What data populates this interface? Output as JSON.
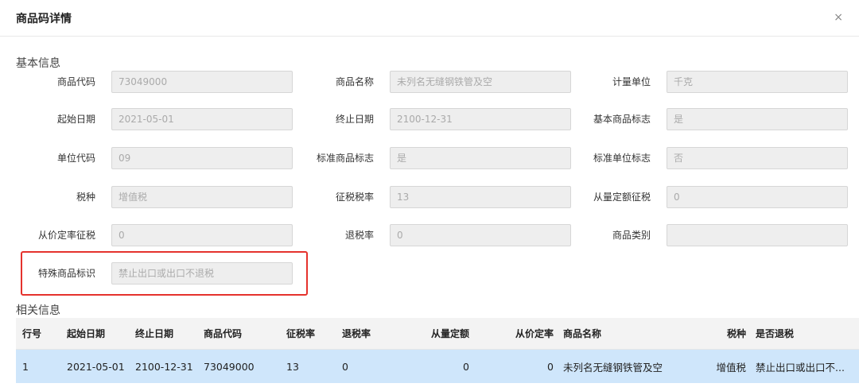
{
  "dialog": {
    "title": "商品码详情",
    "close_label": "×"
  },
  "basic": {
    "section_title": "基本信息",
    "fields": [
      {
        "label": "商品代码",
        "value": "73049000"
      },
      {
        "label": "商品名称",
        "value": "未列名无缝钢铁管及空"
      },
      {
        "label": "计量单位",
        "value": "千克"
      },
      {
        "label": "起始日期",
        "value": "2021-05-01"
      },
      {
        "label": "终止日期",
        "value": "2100-12-31"
      },
      {
        "label": "基本商品标志",
        "value": "是"
      },
      {
        "label": "单位代码",
        "value": "09"
      },
      {
        "label": "标准商品标志",
        "value": "是"
      },
      {
        "label": "标准单位标志",
        "value": "否"
      },
      {
        "label": "税种",
        "value": "增值税"
      },
      {
        "label": "征税税率",
        "value": "13"
      },
      {
        "label": "从量定额征税",
        "value": "0"
      },
      {
        "label": "从价定率征税",
        "value": "0"
      },
      {
        "label": "退税率",
        "value": "0"
      },
      {
        "label": "商品类别",
        "value": ""
      },
      {
        "label": "特殊商品标识",
        "value": "禁止出口或出口不退税"
      }
    ]
  },
  "related": {
    "section_title": "相关信息",
    "columns": [
      "行号",
      "起始日期",
      "终止日期",
      "商品代码",
      "征税率",
      "退税率",
      "从量定额",
      "从价定率",
      "商品名称",
      "税种",
      "是否退税"
    ],
    "rows": [
      [
        "1",
        "2021-05-01",
        "2100-12-31",
        "73049000",
        "13",
        "0",
        "0",
        "0",
        "未列名无缝钢铁管及空",
        "增值税",
        "禁止出口或出口不..."
      ]
    ]
  }
}
